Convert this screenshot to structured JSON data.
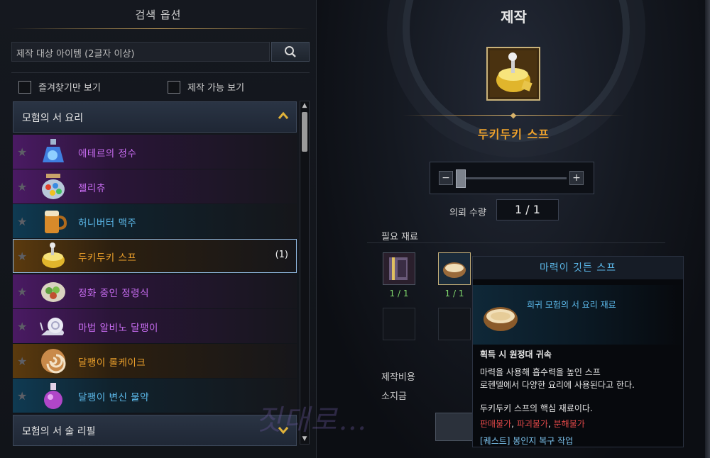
{
  "left_panel": {
    "title": "검색 옵션",
    "search": {
      "value": "제작 대상 아이템 (2글자 이상)",
      "icon": "search-icon"
    },
    "filters": [
      {
        "label": "즐겨찾기만 보기",
        "checked": false
      },
      {
        "label": "제작 가능 보기",
        "checked": false
      }
    ],
    "categories": [
      {
        "label": "모험의 서 요리",
        "expanded": true
      },
      {
        "label": "모험의 서 술 리필",
        "expanded": false
      }
    ],
    "items": [
      {
        "name": "에테르의 정수",
        "rarity": "epic",
        "icon": "potion-bottle-icon",
        "count": ""
      },
      {
        "name": "젤리츄",
        "rarity": "epic",
        "icon": "candy-jar-icon",
        "count": ""
      },
      {
        "name": "허니버터 맥주",
        "rarity": "rare",
        "icon": "beer-mug-icon",
        "count": ""
      },
      {
        "name": "두키두키 스프",
        "rarity": "legend",
        "icon": "soup-pot-icon",
        "count": "(1)",
        "selected": true
      },
      {
        "name": "정화 중인 정령식",
        "rarity": "epic",
        "icon": "salad-plate-icon",
        "count": ""
      },
      {
        "name": "마법 알비노 달팽이",
        "rarity": "epic",
        "icon": "snail-icon",
        "count": ""
      },
      {
        "name": "달팽이 롤케이크",
        "rarity": "legend",
        "icon": "roll-cake-icon",
        "count": ""
      },
      {
        "name": "달팽이 변신 물약",
        "rarity": "rare",
        "icon": "potion-flask-icon",
        "count": ""
      }
    ]
  },
  "craft": {
    "title": "제작",
    "result_name": "두키두키 스프",
    "result_icon": "soup-pot-icon",
    "quantity_label": "의뢰 수량",
    "quantity_value": "1 / 1",
    "slider": {
      "minus": "−",
      "plus": "+",
      "value_fraction": 0.0
    },
    "materials_label": "필요 재료",
    "materials": [
      {
        "icon": "book-icon",
        "count": "1 / 1"
      },
      {
        "icon": "bowl-icon",
        "count": "1 / 1"
      }
    ],
    "cost_label": "제작비용",
    "gold_label": "소지금"
  },
  "tooltip": {
    "name": "마력이 깃든 스프",
    "icon": "bowl-icon",
    "subtitle": "희귀 모험의 서 요리 재료",
    "bind": "획득 시 원정대 귀속",
    "desc1": "마력을 사용해 흡수력을 높인 스프",
    "desc2": "로헨델에서 다양한 요리에 사용된다고 한다.",
    "core": "두키두키 스프의 핵심 재료이다.",
    "flags": [
      "판매불가",
      "파괴불가",
      "분해불가"
    ],
    "quest": "[퀘스트] 봉인지 복구 작업"
  },
  "watermark": "짓대로…",
  "colors": {
    "epic": "#c76cf0",
    "rare": "#5cb9ea",
    "legend": "#f0a32c",
    "ok": "#7ed36b"
  }
}
